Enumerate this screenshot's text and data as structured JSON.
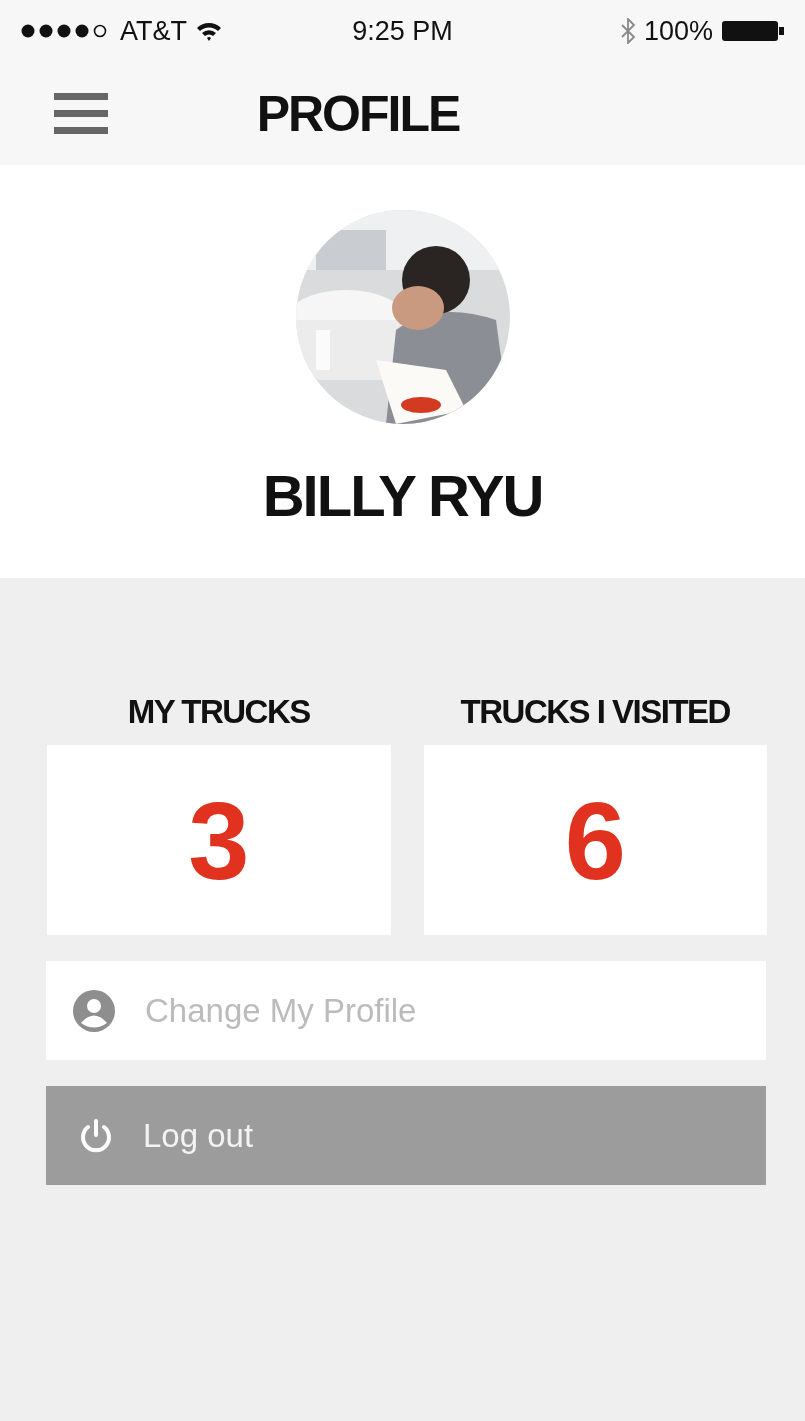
{
  "status_bar": {
    "carrier": "AT&T",
    "time": "9:25 PM",
    "battery": "100%"
  },
  "nav": {
    "title": "PROFILE"
  },
  "profile": {
    "name": "BILLY RYU"
  },
  "stats": [
    {
      "label": "MY TRUCKS",
      "value": "3"
    },
    {
      "label": "TRUCKS I VISITED",
      "value": "6"
    }
  ],
  "actions": [
    {
      "kind": "profile",
      "label": "Change My Profile"
    },
    {
      "kind": "logout",
      "label": "Log out"
    }
  ]
}
